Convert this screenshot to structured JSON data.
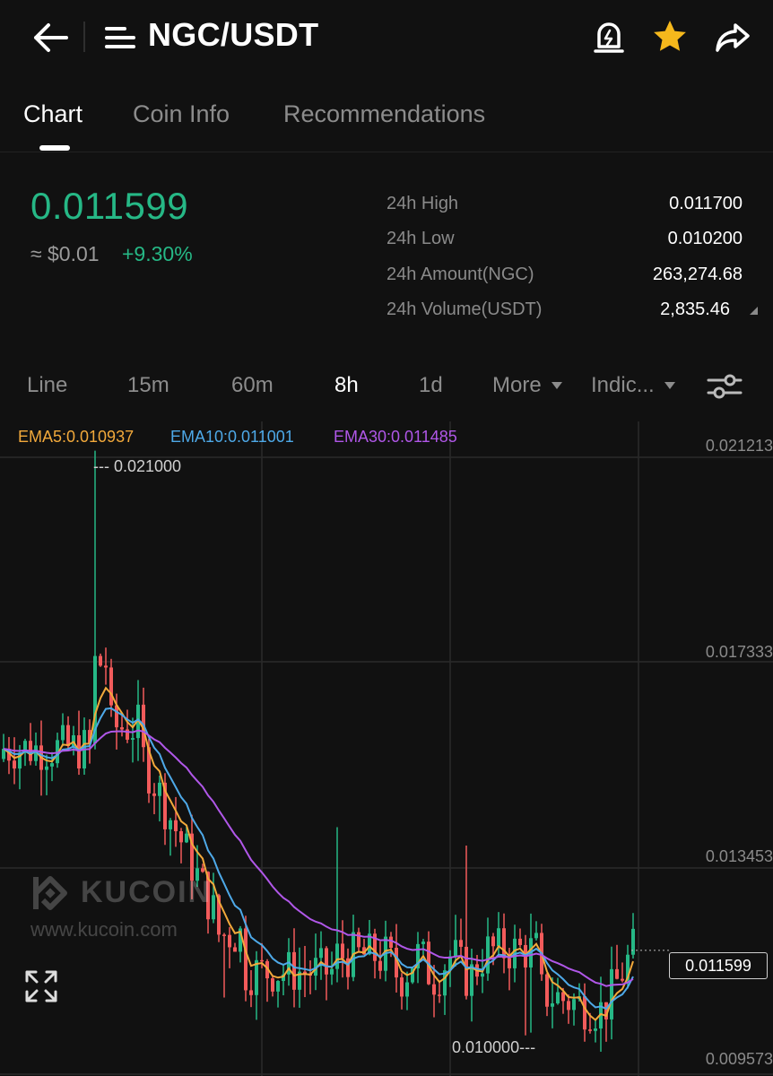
{
  "header": {
    "pair": "NGC/USDT"
  },
  "tabs": [
    {
      "label": "Chart"
    },
    {
      "label": "Coin Info"
    },
    {
      "label": "Recommendations"
    }
  ],
  "ticker": {
    "price": "0.011599",
    "usd": "≈ $0.01",
    "change": "+9.30%"
  },
  "stats": [
    {
      "label": "24h High",
      "value": "0.011700"
    },
    {
      "label": "24h Low",
      "value": "0.010200"
    },
    {
      "label": "24h Amount(NGC)",
      "value": "263,274.68"
    },
    {
      "label": "24h Volume(USDT)",
      "value": "2,835.46"
    }
  ],
  "timeframes": [
    {
      "label": "Line"
    },
    {
      "label": "15m"
    },
    {
      "label": "60m"
    },
    {
      "label": "8h"
    },
    {
      "label": "1d"
    },
    {
      "label": "More"
    },
    {
      "label": "Indic..."
    }
  ],
  "ema": {
    "ema5": "EMA5:0.010937",
    "ema10": "EMA10:0.011001",
    "ema30": "EMA30:0.011485"
  },
  "yaxis": [
    "0.021213",
    "0.017333",
    "0.013453",
    "0.009573"
  ],
  "annotations": {
    "high": "--- 0.021000",
    "low": "0.010000---",
    "current": "0.011599"
  },
  "watermark": {
    "brand": "KUCOIN",
    "url": "www.kucoin.com"
  },
  "colors": {
    "up": "#26b886",
    "down": "#f25b5b",
    "ema5": "#f2a93b",
    "ema10": "#4ea9e8",
    "ema30": "#b057e8",
    "accent": "#f5b81c"
  },
  "chart_data": {
    "type": "candlestick",
    "y_axis_labels": [
      0.021213,
      0.017333,
      0.013453,
      0.009573
    ],
    "ylim": [
      0.009573,
      0.021213
    ],
    "annotated_high": 0.021,
    "annotated_low": 0.01,
    "last_price": 0.011599,
    "series": [
      {
        "name": "EMA5",
        "last": 0.010937
      },
      {
        "name": "EMA10",
        "last": 0.011001
      },
      {
        "name": "EMA30",
        "last": 0.011485
      }
    ]
  }
}
